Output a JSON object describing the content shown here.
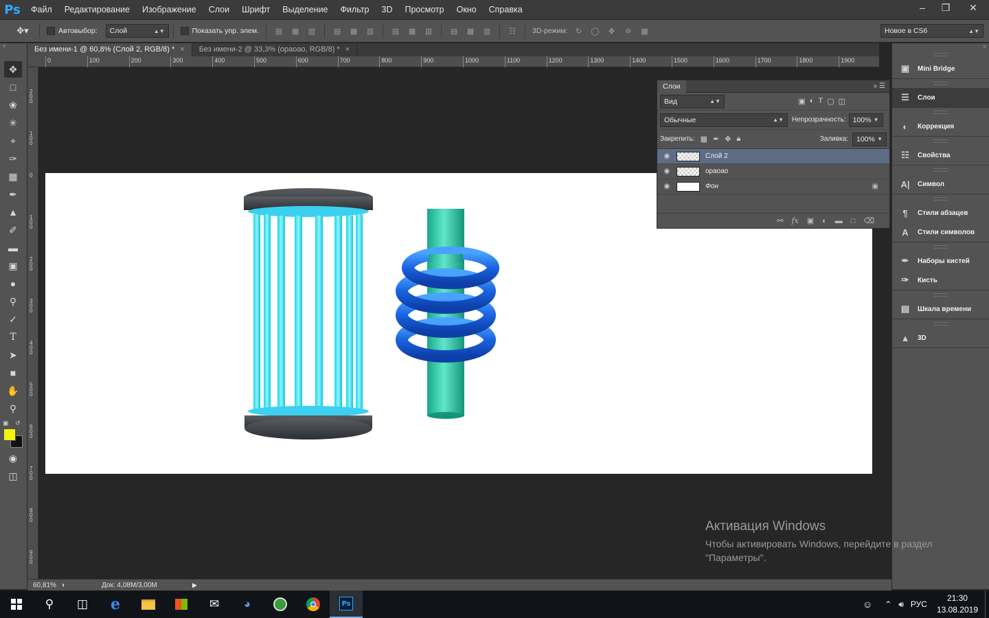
{
  "app": {
    "logo": "Ps"
  },
  "menu": [
    "Файл",
    "Редактирование",
    "Изображение",
    "Слои",
    "Шрифт",
    "Выделение",
    "Фильтр",
    "3D",
    "Просмотр",
    "Окно",
    "Справка"
  ],
  "options": {
    "autoselect_label": "Автовыбор:",
    "autoselect_value": "Слой",
    "show_controls_label": "Показать упр. элем.",
    "mode3d_label": "3D-режим:",
    "workspace_value": "Новое в CS6"
  },
  "tabs": [
    {
      "label": "Без имени-1 @ 60,8% (Слой 2, RGB/8) *",
      "active": true
    },
    {
      "label": "Без имени-2 @ 33,3% (ораоао, RGB/8) *",
      "active": false
    }
  ],
  "ruler_h": [
    "0",
    "100",
    "200",
    "300",
    "400",
    "500",
    "600",
    "700",
    "800",
    "900",
    "1000",
    "1100",
    "1200",
    "1300",
    "1400",
    "1500",
    "1600",
    "1700",
    "1800",
    "1900"
  ],
  "ruler_v": [
    "2 0 0",
    "1 0 0",
    "0",
    "1 0 0",
    "2 0 0",
    "3 0 0",
    "4 0 0",
    "5 0 0",
    "6 0 0",
    "7 0 0",
    "8 0 0",
    "9 0 0"
  ],
  "colors": {
    "foreground": "#f2f20a",
    "background": "#111111",
    "canvas": "#ffffff",
    "selected_layer": "#5e6d85"
  },
  "status": {
    "zoom": "60,81%",
    "doc": "Док: 4,08M/3,00M"
  },
  "layers_panel": {
    "title": "Слои",
    "filter": "Вид",
    "blend_mode": "Обычные",
    "opacity_label": "Непрозрачность:",
    "opacity_value": "100%",
    "lock_label": "Закрепить:",
    "fill_label": "Заливка:",
    "fill_value": "100%",
    "layers": [
      {
        "name": "Слой 2",
        "selected": true
      },
      {
        "name": "ораоао",
        "selected": false
      },
      {
        "name": "Фон",
        "selected": false,
        "locked": true
      }
    ]
  },
  "dock": [
    {
      "label": "Mini Bridge",
      "icon": "mini-bridge-icon"
    },
    {
      "label": "Слои",
      "icon": "layers-icon",
      "selected": true
    },
    {
      "label": "Коррекция",
      "icon": "adjustments-icon"
    },
    {
      "label": "Свойства",
      "icon": "properties-icon"
    },
    {
      "label": "Символ",
      "icon": "character-icon"
    },
    {
      "label": "Стили абзацев",
      "icon": "paragraph-styles-icon"
    },
    {
      "label": "Стили символов",
      "icon": "character-styles-icon"
    },
    {
      "label": "Наборы кистей",
      "icon": "brush-presets-icon"
    },
    {
      "label": "Кисть",
      "icon": "brush-icon"
    },
    {
      "label": "Шкала времени",
      "icon": "timeline-icon"
    },
    {
      "label": "3D",
      "icon": "3d-icon"
    }
  ],
  "watermark": {
    "title": "Активация Windows",
    "text": "Чтобы активировать Windows, перейдите в раздел \"Параметры\"."
  },
  "taskbar": {
    "lang": "РУС",
    "time": "21:30",
    "date": "13.08.2019"
  }
}
